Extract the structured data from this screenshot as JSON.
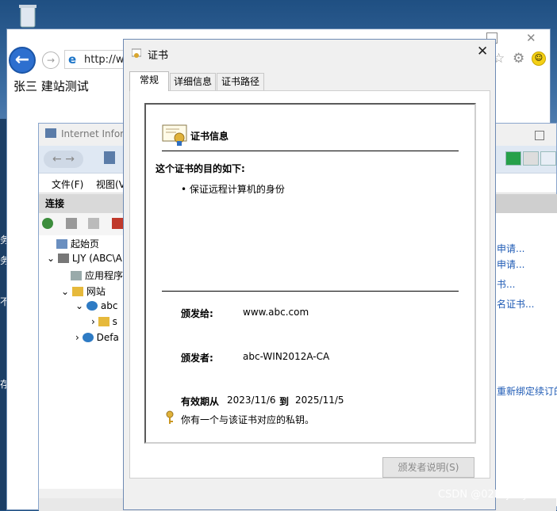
{
  "browser": {
    "address": "http://w",
    "page_text": "张三  建站测试"
  },
  "iis": {
    "title": "Internet Infor",
    "menu": [
      "文件(F)",
      "视图(V"
    ],
    "connections_header": "连接",
    "tree": [
      "起始页",
      "LJY (ABC\\A",
      "应用程序",
      "网站",
      "abc",
      "s",
      "Defa"
    ],
    "actions": [
      "申请...",
      "申请...",
      "书...",
      "名证书...",
      "重新绑定续订的"
    ]
  },
  "dialog": {
    "title": "证书",
    "tabs": [
      "常规",
      "详细信息",
      "证书路径"
    ],
    "info_title": "证书信息",
    "purpose_heading": "这个证书的目的如下:",
    "purpose_item": "• 保证远程计算机的身份",
    "issued_to_label": "颁发给:",
    "issued_to_value": "www.abc.com",
    "issued_by_label": "颁发者:",
    "issued_by_value": "abc-WIN2012A-CA",
    "valid_label": "有效期从",
    "valid_from": "2023/11/6",
    "valid_to_label": "到",
    "valid_to": "2025/11/5",
    "private_key_text": "你有一个与该证书对应的私钥。",
    "issuer_statement_button": "颁发者说明(S)",
    "close_icon": "close-icon"
  },
  "left_strip_chars": [
    "务",
    "务",
    "不",
    "存"
  ],
  "watermark": "CSDN @02liujunye",
  "icons": [
    "recycle-bin-icon",
    "back-arrow-icon",
    "forward-arrow-icon",
    "ie-logo-icon",
    "star-icon",
    "gear-icon",
    "smiley-icon",
    "certificate-icon",
    "key-icon",
    "globe-icon",
    "folder-icon"
  ]
}
